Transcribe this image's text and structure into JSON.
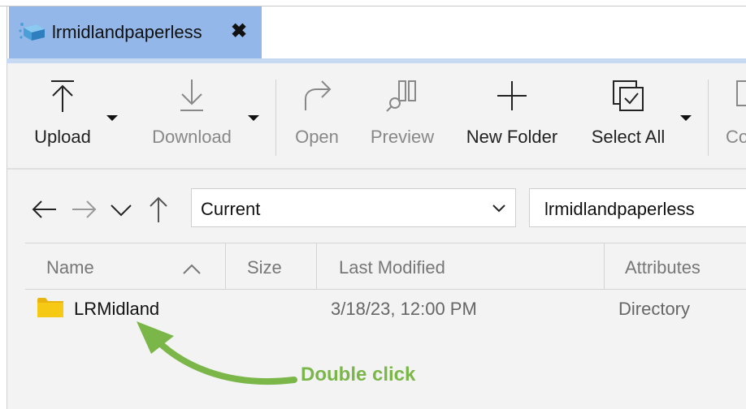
{
  "tab": {
    "title": "lrmidlandpaperless",
    "close_symbol": "✖",
    "icon": "cloud-drive-icon"
  },
  "ribbon": {
    "upload": "Upload",
    "download": "Download",
    "open": "Open",
    "preview": "Preview",
    "new_folder": "New Folder",
    "select_all": "Select All",
    "copy_partial": "Co"
  },
  "navigation": {
    "location_value": "Current",
    "path_value": "lrmidlandpaperless"
  },
  "table": {
    "columns": [
      "Name",
      "Size",
      "Last Modified",
      "Attributes"
    ],
    "sorted_column": "Name",
    "sort_direction": "ascending",
    "rows": [
      {
        "name": "LRMidland",
        "size": "",
        "modified": "3/18/23, 12:00 PM",
        "attributes": "Directory",
        "icon": "folder-icon"
      }
    ]
  },
  "annotation": {
    "text": "Double click",
    "color": "#7ab648"
  },
  "colors": {
    "tab_active": "#93b7e8",
    "tab_underline": "#c8d9f3",
    "panel_bg": "#f3f3f3",
    "folder": "#f6c915"
  }
}
